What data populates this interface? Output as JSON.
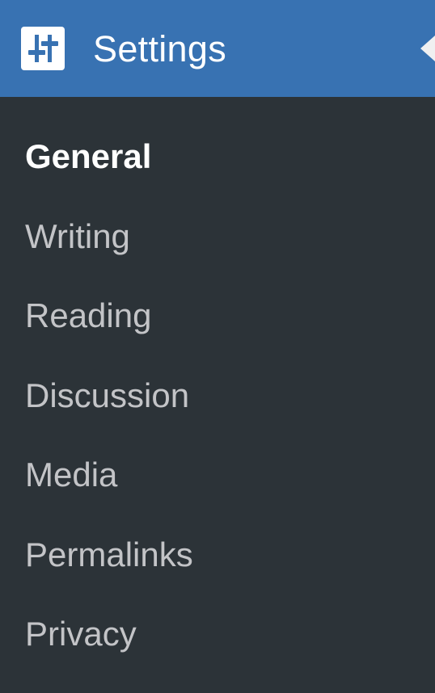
{
  "header": {
    "title": "Settings",
    "icon": "settings-sliders-icon"
  },
  "colors": {
    "header_bg": "#3872b2",
    "menu_bg": "#2c3338",
    "active_text": "#ffffff",
    "inactive_text": "#c3c4c7"
  },
  "submenu": {
    "items": [
      {
        "label": "General",
        "active": true
      },
      {
        "label": "Writing",
        "active": false
      },
      {
        "label": "Reading",
        "active": false
      },
      {
        "label": "Discussion",
        "active": false
      },
      {
        "label": "Media",
        "active": false
      },
      {
        "label": "Permalinks",
        "active": false
      },
      {
        "label": "Privacy",
        "active": false
      }
    ]
  }
}
